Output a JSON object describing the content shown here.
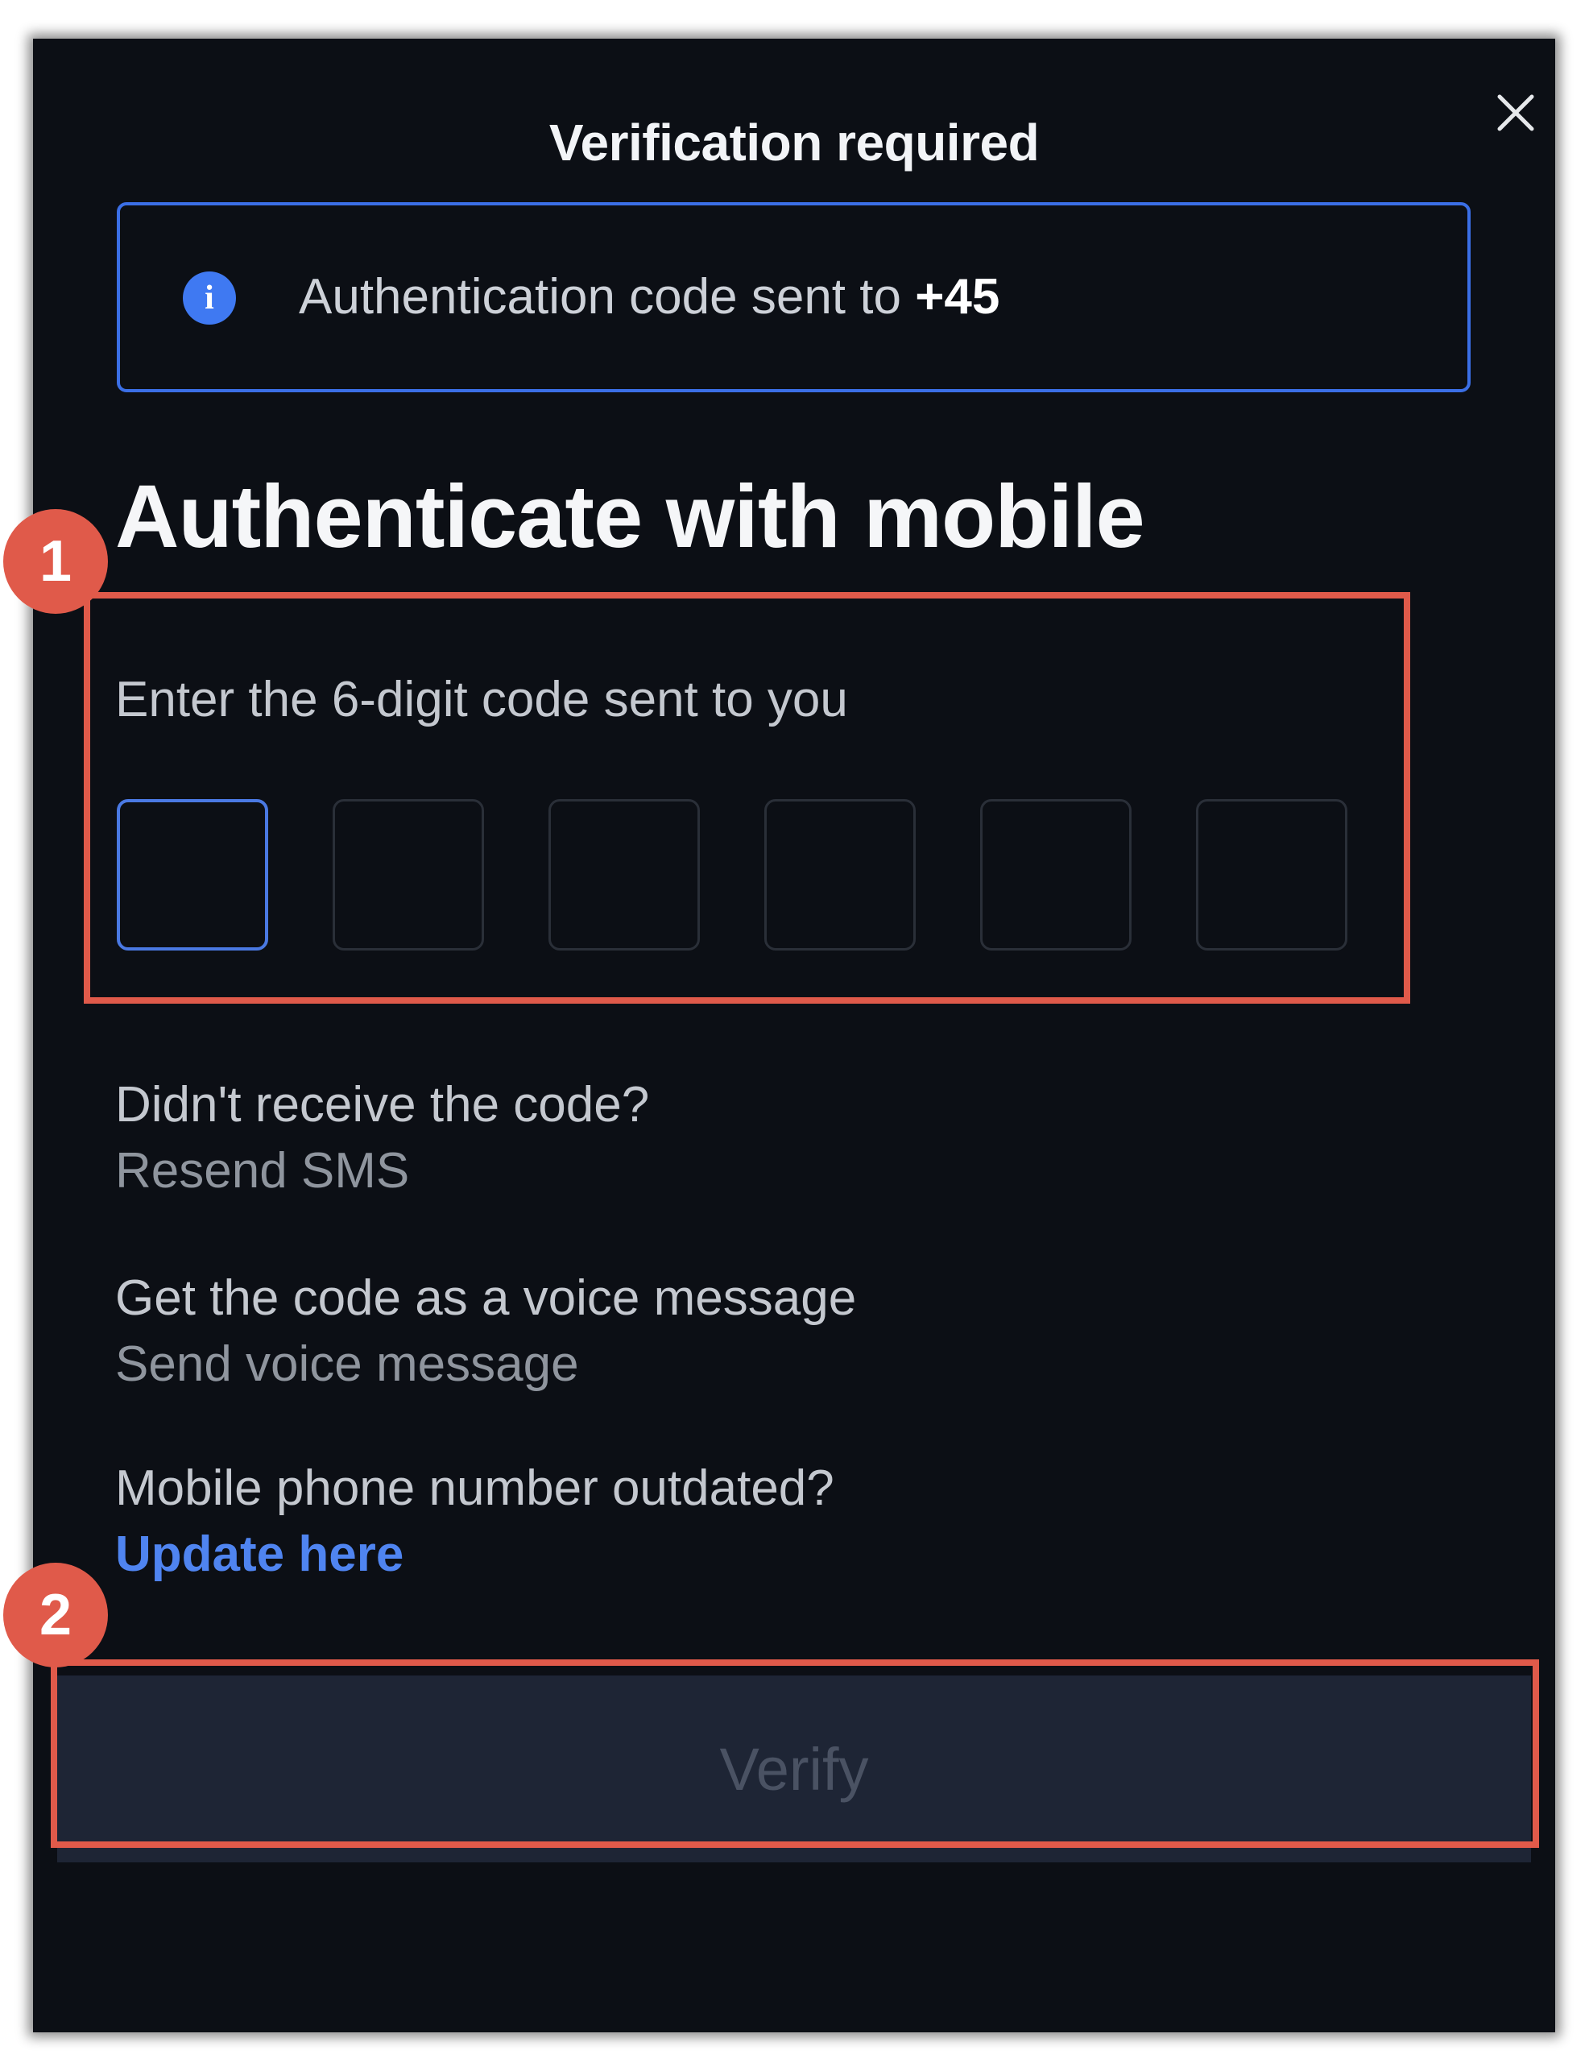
{
  "dialog": {
    "title": "Verification required",
    "close_icon": "close-icon"
  },
  "info_banner": {
    "icon": "info-icon",
    "icon_glyph": "i",
    "text": "Authentication code sent to ",
    "phone": "+45"
  },
  "heading": "Authenticate with mobile",
  "code_entry": {
    "label": "Enter the 6-digit code sent to you",
    "digits": [
      "",
      "",
      "",
      "",
      "",
      ""
    ]
  },
  "resend_sms": {
    "question": "Didn't receive the code?",
    "action": "Resend SMS"
  },
  "voice_message": {
    "question": "Get the code as a voice message",
    "action": "Send voice message"
  },
  "update_phone": {
    "question": "Mobile phone number outdated?",
    "action": "Update here"
  },
  "verify_button": {
    "label": "Verify"
  },
  "annotations": {
    "badge_1": "1",
    "badge_2": "2"
  },
  "colors": {
    "background": "#0c0f15",
    "accent": "#3f79f2",
    "link": "#4f84f0",
    "annotation": "#e05a4a",
    "button_disabled": "#1e2535"
  }
}
